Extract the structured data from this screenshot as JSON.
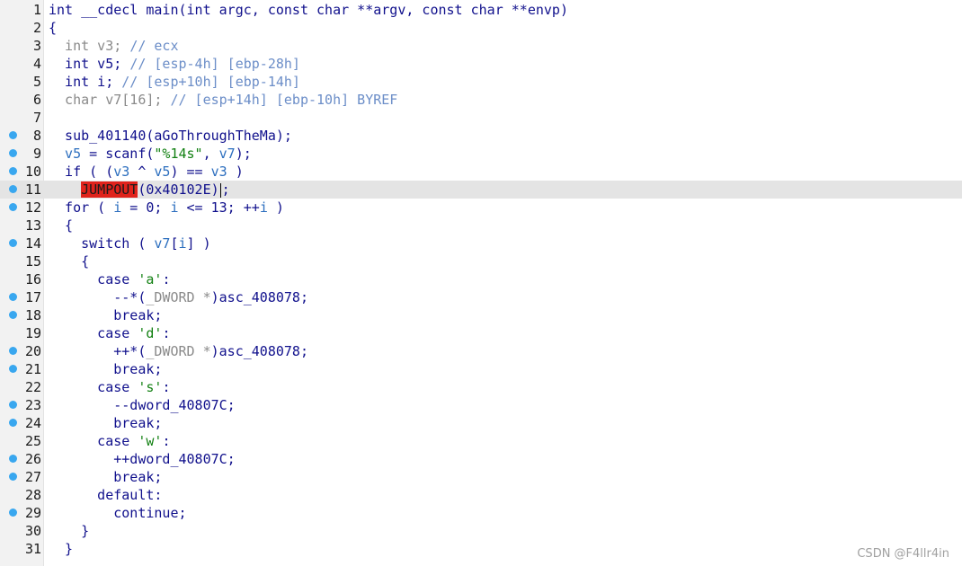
{
  "editor": {
    "breakpoint_color": "#39a7ef",
    "highlight_color": "#e0231c",
    "current_line": 11,
    "lines": [
      {
        "n": "1",
        "bp": false,
        "tokens": [
          [
            "k",
            "int __cdecl main(int argc, const char **argv, const char **envp)"
          ]
        ]
      },
      {
        "n": "2",
        "bp": false,
        "tokens": [
          [
            "k",
            "{"
          ]
        ]
      },
      {
        "n": "3",
        "bp": false,
        "tokens": [
          [
            "g",
            "  int v3; "
          ],
          [
            "c",
            "// ecx"
          ]
        ]
      },
      {
        "n": "4",
        "bp": false,
        "tokens": [
          [
            "k",
            "  int v5; "
          ],
          [
            "c",
            "// [esp-4h] [ebp-28h]"
          ]
        ]
      },
      {
        "n": "5",
        "bp": false,
        "tokens": [
          [
            "k",
            "  int i; "
          ],
          [
            "c",
            "// [esp+10h] [ebp-14h]"
          ]
        ]
      },
      {
        "n": "6",
        "bp": false,
        "tokens": [
          [
            "g",
            "  char v7[16]; "
          ],
          [
            "c",
            "// [esp+14h] [ebp-10h] BYREF"
          ]
        ]
      },
      {
        "n": "7",
        "bp": false,
        "tokens": []
      },
      {
        "n": "8",
        "bp": true,
        "tokens": [
          [
            "k",
            "  sub_401140(aGoThroughTheMa);"
          ]
        ]
      },
      {
        "n": "9",
        "bp": true,
        "tokens": [
          [
            "v",
            "  v5"
          ],
          [
            "k",
            " = scanf("
          ],
          [
            "s",
            "\"%14s\""
          ],
          [
            "k",
            ", "
          ],
          [
            "v",
            "v7"
          ],
          [
            "k",
            ");"
          ]
        ]
      },
      {
        "n": "10",
        "bp": true,
        "tokens": [
          [
            "k",
            "  if ( ("
          ],
          [
            "v",
            "v3"
          ],
          [
            "k",
            " ^ "
          ],
          [
            "v",
            "v5"
          ],
          [
            "k",
            ") == "
          ],
          [
            "v",
            "v3"
          ],
          [
            "k",
            " )"
          ]
        ]
      },
      {
        "n": "11",
        "bp": true,
        "tokens": [
          [
            "k",
            "    "
          ],
          [
            "hl",
            "JUMPOUT"
          ],
          [
            "k",
            "(0x40102E)"
          ],
          [
            "cursor",
            ""
          ],
          [
            "k",
            ";"
          ]
        ]
      },
      {
        "n": "12",
        "bp": true,
        "tokens": [
          [
            "k",
            "  for ( "
          ],
          [
            "v",
            "i"
          ],
          [
            "k",
            " = 0; "
          ],
          [
            "v",
            "i"
          ],
          [
            "k",
            " <= 13; ++"
          ],
          [
            "v",
            "i"
          ],
          [
            "k",
            " )"
          ]
        ]
      },
      {
        "n": "13",
        "bp": false,
        "tokens": [
          [
            "k",
            "  {"
          ]
        ]
      },
      {
        "n": "14",
        "bp": true,
        "tokens": [
          [
            "k",
            "    switch ( "
          ],
          [
            "v",
            "v7"
          ],
          [
            "k",
            "["
          ],
          [
            "v",
            "i"
          ],
          [
            "k",
            "] )"
          ]
        ]
      },
      {
        "n": "15",
        "bp": false,
        "tokens": [
          [
            "k",
            "    {"
          ]
        ]
      },
      {
        "n": "16",
        "bp": false,
        "tokens": [
          [
            "k",
            "      case "
          ],
          [
            "s",
            "'a'"
          ],
          [
            "k",
            ":"
          ]
        ]
      },
      {
        "n": "17",
        "bp": true,
        "tokens": [
          [
            "k",
            "        --*("
          ],
          [
            "g",
            "_DWORD *"
          ],
          [
            "k",
            ")asc_408078;"
          ]
        ]
      },
      {
        "n": "18",
        "bp": true,
        "tokens": [
          [
            "k",
            "        break;"
          ]
        ]
      },
      {
        "n": "19",
        "bp": false,
        "tokens": [
          [
            "k",
            "      case "
          ],
          [
            "s",
            "'d'"
          ],
          [
            "k",
            ":"
          ]
        ]
      },
      {
        "n": "20",
        "bp": true,
        "tokens": [
          [
            "k",
            "        ++*("
          ],
          [
            "g",
            "_DWORD *"
          ],
          [
            "k",
            ")asc_408078;"
          ]
        ]
      },
      {
        "n": "21",
        "bp": true,
        "tokens": [
          [
            "k",
            "        break;"
          ]
        ]
      },
      {
        "n": "22",
        "bp": false,
        "tokens": [
          [
            "k",
            "      case "
          ],
          [
            "s",
            "'s'"
          ],
          [
            "k",
            ":"
          ]
        ]
      },
      {
        "n": "23",
        "bp": true,
        "tokens": [
          [
            "k",
            "        --dword_40807C;"
          ]
        ]
      },
      {
        "n": "24",
        "bp": true,
        "tokens": [
          [
            "k",
            "        break;"
          ]
        ]
      },
      {
        "n": "25",
        "bp": false,
        "tokens": [
          [
            "k",
            "      case "
          ],
          [
            "s",
            "'w'"
          ],
          [
            "k",
            ":"
          ]
        ]
      },
      {
        "n": "26",
        "bp": true,
        "tokens": [
          [
            "k",
            "        ++dword_40807C;"
          ]
        ]
      },
      {
        "n": "27",
        "bp": true,
        "tokens": [
          [
            "k",
            "        break;"
          ]
        ]
      },
      {
        "n": "28",
        "bp": false,
        "tokens": [
          [
            "k",
            "      default:"
          ]
        ]
      },
      {
        "n": "29",
        "bp": true,
        "tokens": [
          [
            "k",
            "        continue;"
          ]
        ]
      },
      {
        "n": "30",
        "bp": false,
        "tokens": [
          [
            "k",
            "    }"
          ]
        ]
      },
      {
        "n": "31",
        "bp": false,
        "tokens": [
          [
            "k",
            "  }"
          ]
        ]
      }
    ]
  },
  "watermark": "CSDN @F4llr4in"
}
